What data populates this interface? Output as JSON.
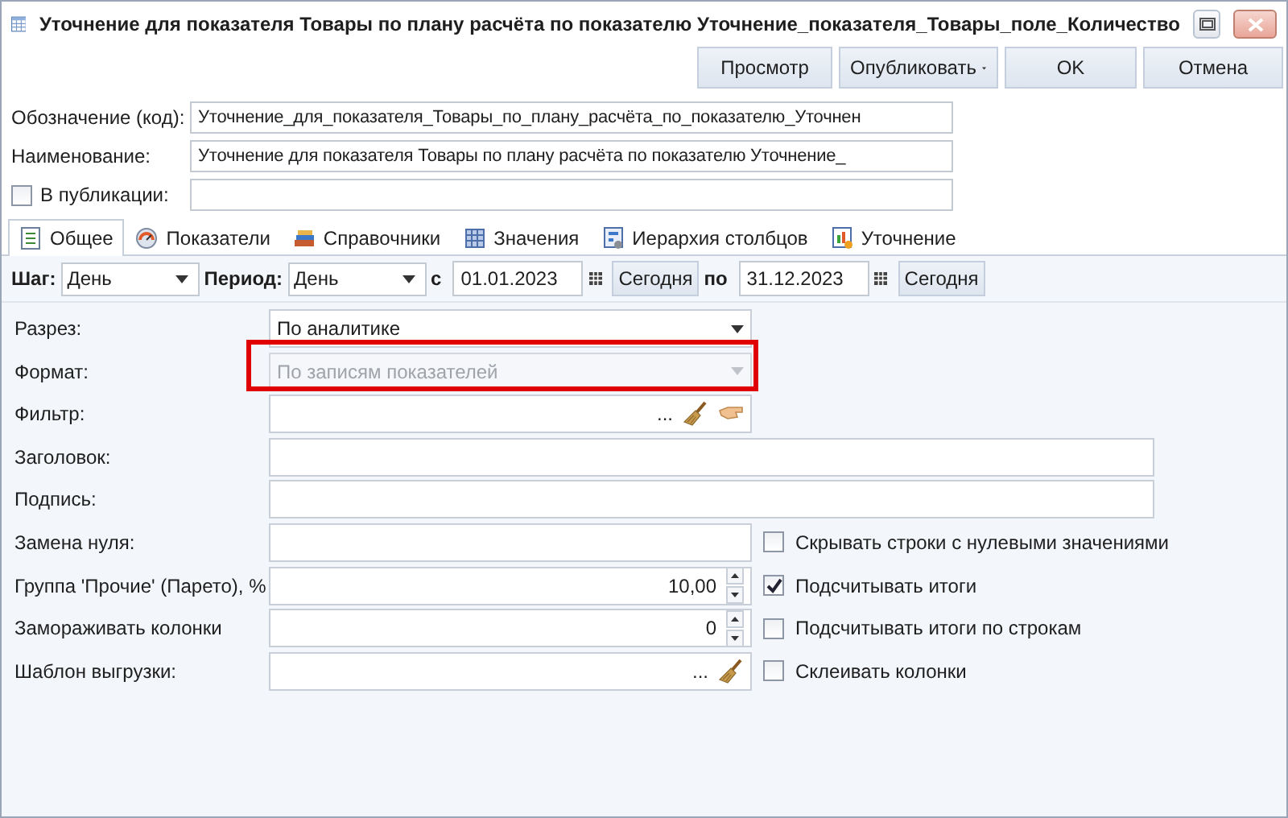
{
  "window": {
    "title": "Уточнение для показателя Товары по плану расчёта по показателю Уточнение_показателя_Товары_поле_Количество"
  },
  "toolbar": [
    {
      "label": "Просмотр",
      "kind": "button"
    },
    {
      "label": "Опубликовать",
      "kind": "dropdown"
    },
    {
      "label": "OK",
      "kind": "button"
    },
    {
      "label": "Отмена",
      "kind": "button"
    }
  ],
  "header_fields": [
    {
      "kind": "text",
      "label": "Обозначение (код):",
      "value": "Уточнение_для_показателя_Товары_по_плану_расчёта_по_показателю_Уточнен"
    },
    {
      "kind": "text",
      "label": "Наименование:",
      "value": "Уточнение для показателя Товары по плану расчёта по показателю Уточнение_"
    },
    {
      "kind": "checkbox",
      "label": "В публикации:",
      "checked": false
    }
  ],
  "tabs": [
    {
      "label": "Общее",
      "selected": true
    },
    {
      "label": "Показатели",
      "selected": false
    },
    {
      "label": "Справочники",
      "selected": false
    },
    {
      "label": "Значения",
      "selected": false
    },
    {
      "label": "Иерархия столбцов",
      "selected": false
    },
    {
      "label": "Уточнение",
      "selected": false
    }
  ],
  "period": {
    "step_label": "Шаг:",
    "step": "День",
    "period_label": "Период:",
    "period": "День",
    "from_label": "с",
    "from": "01.01.2023",
    "from_today": "Сегодня",
    "to_label": "по",
    "to": "31.12.2023",
    "to_today": "Сегодня"
  },
  "form": [
    {
      "kind": "select",
      "label": "Разрез:",
      "value": "По аналитике",
      "disabled": false
    },
    {
      "kind": "select",
      "label": "Формат:",
      "value": "По записям показателей",
      "disabled": true,
      "highlighted": true
    },
    {
      "kind": "picker",
      "label": "Фильтр:",
      "ellipsis": "...",
      "tools": [
        {
          "kind": "broom"
        },
        {
          "kind": "hand"
        }
      ]
    },
    {
      "kind": "text",
      "label": "Заголовок:"
    },
    {
      "kind": "text",
      "label": "Подпись:"
    },
    {
      "kind": "text",
      "label": "Замена нуля:",
      "option": {
        "label": "Скрывать строки с нулевыми значениями",
        "checked": false
      }
    },
    {
      "kind": "spin",
      "label": "Группа 'Прочие' (Парето), %",
      "value": "10,00",
      "option": {
        "label": "Подсчитывать итоги",
        "checked": true
      }
    },
    {
      "kind": "spin",
      "label": "Замораживать колонки",
      "value": "0",
      "option": {
        "label": "Подсчитывать итоги по строкам",
        "checked": false
      }
    },
    {
      "kind": "picker",
      "label": "Шаблон выгрузки:",
      "ellipsis": "...",
      "tools": [
        {
          "kind": "broom"
        }
      ],
      "option": {
        "label": "Склеивать колонки",
        "checked": false
      }
    }
  ]
}
